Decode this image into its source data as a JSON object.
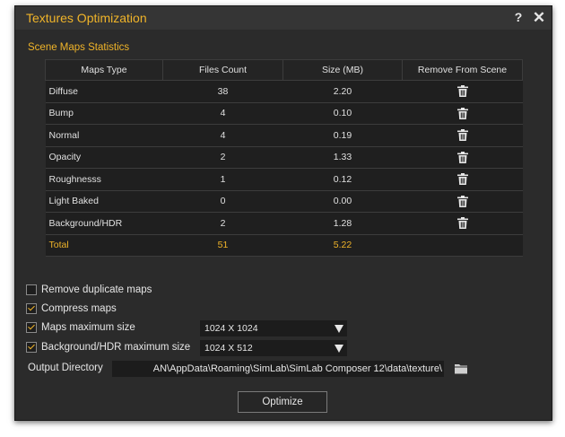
{
  "window": {
    "title": "Textures Optimization",
    "help": "?",
    "close": "✕"
  },
  "stats": {
    "title": "Scene Maps Statistics",
    "headers": [
      "Maps Type",
      "Files Count",
      "Size (MB)",
      "Remove From Scene"
    ],
    "rows": [
      {
        "type": "Diffuse",
        "count": "38",
        "size": "2.20"
      },
      {
        "type": "Bump",
        "count": "4",
        "size": "0.10"
      },
      {
        "type": "Normal",
        "count": "4",
        "size": "0.19"
      },
      {
        "type": "Opacity",
        "count": "2",
        "size": "1.33"
      },
      {
        "type": "Roughnesss",
        "count": "1",
        "size": "0.12"
      },
      {
        "type": "Light Baked",
        "count": "0",
        "size": "0.00"
      },
      {
        "type": "Background/HDR",
        "count": "2",
        "size": "1.28"
      }
    ],
    "total": {
      "label": "Total",
      "count": "51",
      "size": "5.22"
    }
  },
  "options": {
    "remove_duplicates": {
      "label": "Remove duplicate maps",
      "checked": false
    },
    "compress": {
      "label": "Compress maps",
      "checked": true
    },
    "maps_max": {
      "label": "Maps maximum size",
      "checked": true,
      "value": "1024 X 1024"
    },
    "bg_max": {
      "label": "Background/HDR maximum size",
      "checked": true,
      "value": "1024 X 512"
    }
  },
  "output": {
    "label": "Output Directory",
    "path": "AN\\AppData\\Roaming\\SimLab\\SimLab Composer 12\\data\\texture\\"
  },
  "optimize_label": "Optimize",
  "colors": {
    "accent": "#f0b429",
    "background": "#2b2b2b",
    "table_row": "#1f1f1f"
  }
}
